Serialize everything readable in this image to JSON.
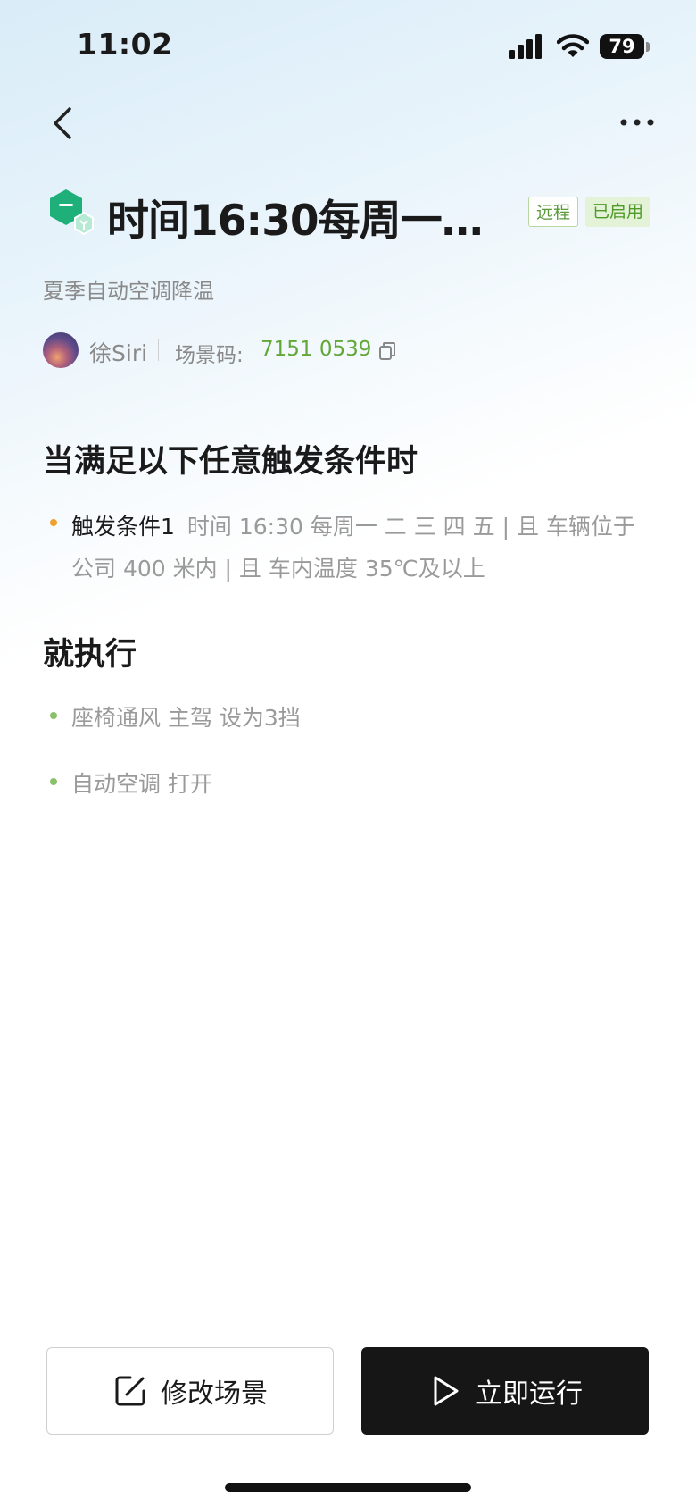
{
  "status_bar": {
    "time": "11:02",
    "battery": "79"
  },
  "header": {
    "title": "时间16:30每周一二...",
    "tags": {
      "remote": "远程",
      "enabled": "已启用"
    },
    "subtitle": "夏季自动空调降温",
    "author": "徐Siri",
    "scene_code_label": "场景码:",
    "scene_code": "7151 0539"
  },
  "trigger_section": {
    "heading": "当满足以下任意触发条件时",
    "conditions": [
      {
        "name": "触发条件1",
        "text": "时间 16:30 每周一 二 三 四 五 | 且 车辆位于 公司 400 米内 | 且 车内温度 35℃及以上"
      }
    ]
  },
  "action_section": {
    "heading": "就执行",
    "actions": [
      "座椅通风 主驾 设为3挡",
      "自动空调 打开"
    ]
  },
  "buttons": {
    "edit": "修改场景",
    "run": "立即运行"
  },
  "icons": [
    "signal-icon",
    "wifi-icon",
    "battery-icon",
    "back-arrow-icon",
    "more-icon",
    "scene-icon",
    "copy-icon",
    "edit-icon",
    "play-icon"
  ]
}
